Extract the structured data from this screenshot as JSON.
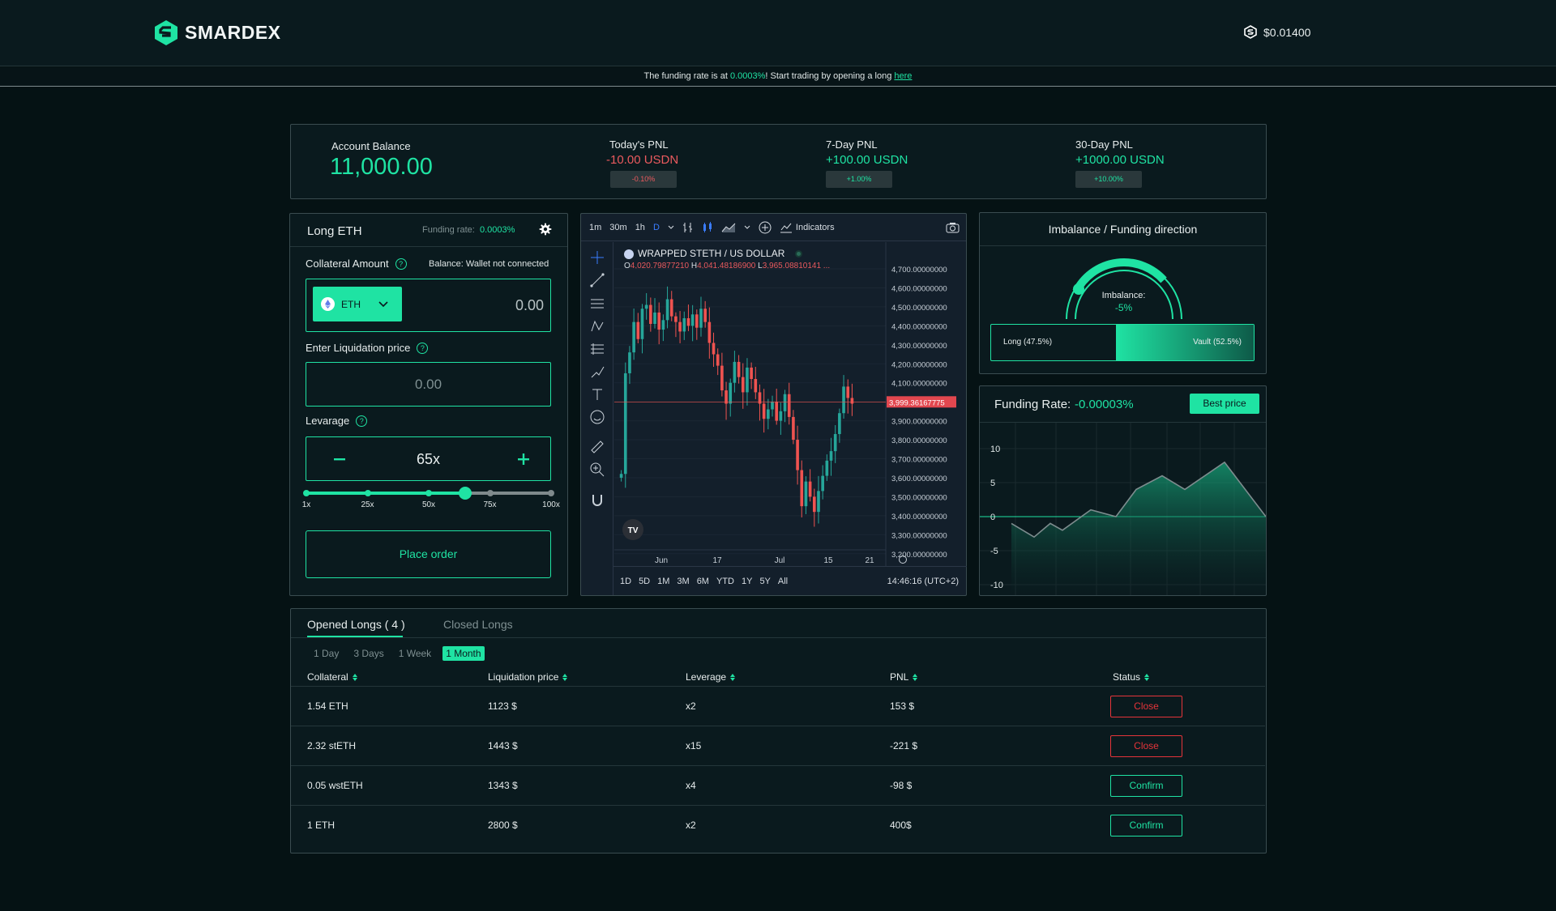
{
  "header": {
    "brand": "SMARDEX",
    "token_price": "$0.01400"
  },
  "banner": {
    "prefix": "The funding rate is at",
    "rate": "0.0003%",
    "middle": "! Start trading by opening a long",
    "link": "here"
  },
  "stats": {
    "balance": {
      "label": "Account Balance",
      "value": "11,000.00"
    },
    "today": {
      "label": "Today's PNL",
      "value": "-10.00 USDN",
      "pct": "-0.10%"
    },
    "week": {
      "label": "7-Day PNL",
      "value": "+100.00 USDN",
      "pct": "+1.00%"
    },
    "month": {
      "label": "30-Day PNL",
      "value": "+1000.00 USDN",
      "pct": "+10.00%"
    }
  },
  "order": {
    "title": "Long ETH",
    "funding_label": "Funding rate:",
    "funding_value": "0.0003%",
    "collateral_label": "Collateral Amount",
    "balance_text": "Balance: Wallet not connected",
    "token": "ETH",
    "collateral_value": "0.00",
    "liq_label": "Enter Liquidation price",
    "liq_value": "0.00",
    "leverage_label": "Levarage",
    "leverage_value": "65x",
    "leverage_fraction": 0.65,
    "slider_ticks": [
      "1x",
      "25x",
      "50x",
      "75x",
      "100x"
    ],
    "place_order": "Place order",
    "help": "?"
  },
  "chart": {
    "timeframes": [
      "1m",
      "30m",
      "1h",
      "D"
    ],
    "indicators": "Indicators",
    "symbol": "WRAPPED STETH / US DOLLAR",
    "ohlc_o": "4,020.79877210",
    "ohlc_h": "4,041.48186900",
    "ohlc_l": "3,965.08810141 ...",
    "price_labels": [
      "4,700.00000000",
      "4,600.00000000",
      "4,500.00000000",
      "4,400.00000000",
      "4,300.00000000",
      "4,200.00000000",
      "4,100.00000000",
      "4,000.00000000",
      "3,900.00000000",
      "3,800.00000000",
      "3,700.00000000",
      "3,600.00000000",
      "3,500.00000000",
      "3,400.00000000",
      "3,300.00000000",
      "3,200.00000000"
    ],
    "current_price": "3,999.36167775",
    "x_labels": [
      "Jun",
      "17",
      "Jul",
      "15",
      "21"
    ],
    "ranges": [
      "1D",
      "5D",
      "1M",
      "3M",
      "6M",
      "YTD",
      "1Y",
      "5Y",
      "All"
    ],
    "time": "14:46:16 (UTC+2)",
    "logo": "TV"
  },
  "imbalance": {
    "title": "Imbalance / Funding direction",
    "label": "Imbalance:",
    "value": "-5%",
    "long": "Long  (47.5%)",
    "vault": "Vault  (52.5%)",
    "long_fraction": 0.475
  },
  "funding": {
    "title": "Funding Rate:",
    "value": "-0.00003%",
    "best": "Best price",
    "y_ticks": [
      "10",
      "5",
      "0",
      "-5",
      "-10"
    ]
  },
  "positions": {
    "tabs": [
      "Opened Longs ( 4 )",
      "Closed Longs"
    ],
    "filters": [
      "1 Day",
      "3 Days",
      "1 Week",
      "1 Month"
    ],
    "columns": [
      "Collateral",
      "Liquidation price",
      "Leverage",
      "PNL",
      "Status"
    ],
    "rows": [
      {
        "collateral": "1.54 ETH",
        "liq": "1123 $",
        "lev": "x2",
        "pnl": "153 $",
        "status": "Close"
      },
      {
        "collateral": "2.32 stETH",
        "liq": "1443 $",
        "lev": "x15",
        "pnl": "-221 $",
        "status": "Close"
      },
      {
        "collateral": "0.05 wstETH",
        "liq": "1343 $",
        "lev": "x4",
        "pnl": "-98 $",
        "status": "Confirm"
      },
      {
        "collateral": "1 ETH",
        "liq": "2800 $",
        "lev": "x2",
        "pnl": "400$",
        "status": "Confirm"
      }
    ]
  },
  "colors": {
    "accent": "#1fe3a3",
    "negative": "#ea5a5e",
    "background": "#051214"
  }
}
